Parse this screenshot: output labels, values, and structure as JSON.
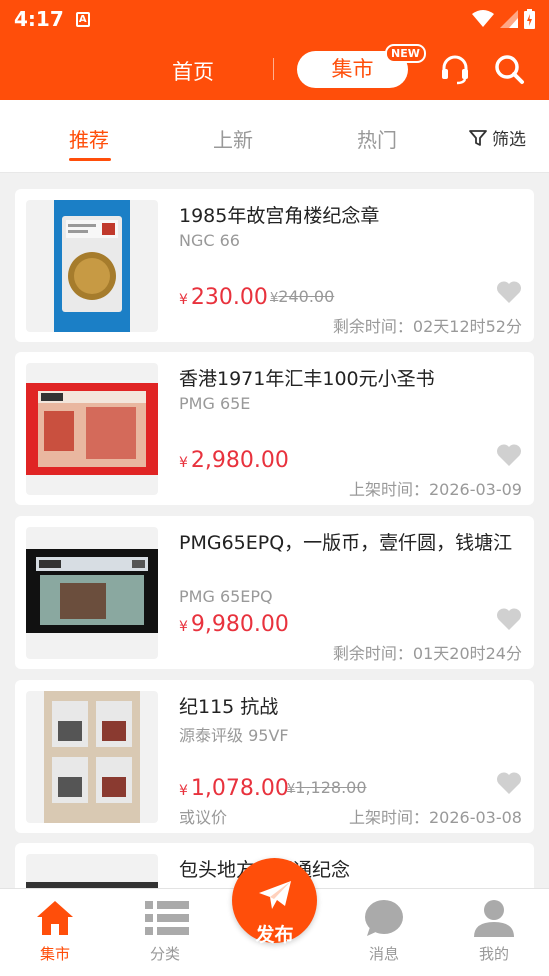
{
  "status_bar": {
    "time": "4:17",
    "app_icon": "A"
  },
  "header": {
    "home_label": "首页",
    "market_label": "集市",
    "new_badge": "NEW"
  },
  "tabs": [
    {
      "label": "推荐",
      "active": true
    },
    {
      "label": "上新",
      "active": false
    },
    {
      "label": "热门",
      "active": false
    }
  ],
  "filter": {
    "label": "筛选"
  },
  "currency": "¥",
  "items": [
    {
      "title": "1985年故宫角楼纪念章",
      "subtitle": "NGC 66",
      "price": "230.00",
      "old_price": "240.00",
      "time": "剩余时间：02天12时52分"
    },
    {
      "title": "香港1971年汇丰100元小圣书",
      "subtitle": "PMG 65E",
      "price": "2,980.00",
      "time": "上架时间：2026-03-09"
    },
    {
      "title": "PMG65EPQ，一版币，壹仟圆，钱塘江",
      "subtitle": "PMG 65EPQ",
      "price": "9,980.00",
      "time": "剩余时间：01天20时24分"
    },
    {
      "title": "纪115 抗战",
      "subtitle": "源泰评级 95VF",
      "price": "1,078.00",
      "old_price": "1,128.00",
      "negotiable": "或议价",
      "time": "上架时间：2026-03-08"
    },
    {
      "title": "包头地方卡开通纪念"
    }
  ],
  "bottom_nav": {
    "market": "集市",
    "category": "分类",
    "publish": "发布",
    "messages": "消息",
    "mine": "我的"
  },
  "colors": {
    "brand": "#ff4e0a",
    "price": "#e8323d"
  }
}
